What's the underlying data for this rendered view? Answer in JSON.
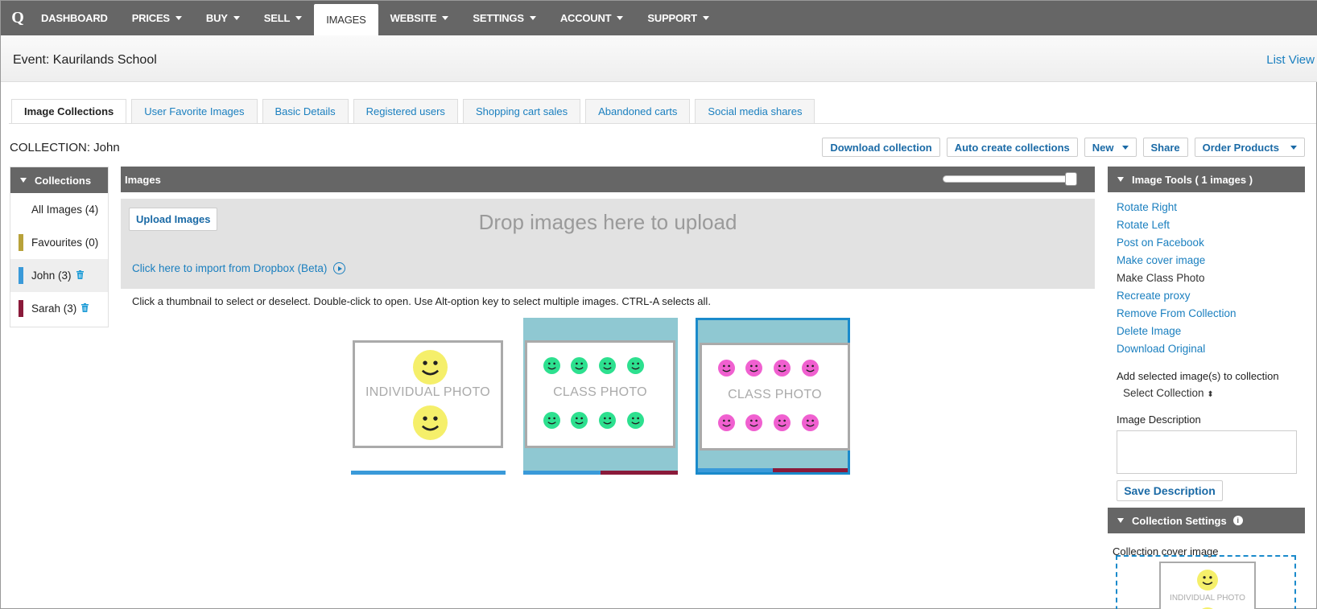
{
  "nav": {
    "logo": "Q",
    "items": [
      {
        "label": "DASHBOARD",
        "caret": false,
        "active": false
      },
      {
        "label": "PRICES",
        "caret": true,
        "active": false
      },
      {
        "label": "BUY",
        "caret": true,
        "active": false
      },
      {
        "label": "SELL",
        "caret": true,
        "active": false
      },
      {
        "label": "IMAGES",
        "caret": false,
        "active": true
      },
      {
        "label": "WEBSITE",
        "caret": true,
        "active": false
      },
      {
        "label": "SETTINGS",
        "caret": true,
        "active": false
      },
      {
        "label": "ACCOUNT",
        "caret": true,
        "active": false
      },
      {
        "label": "SUPPORT",
        "caret": true,
        "active": false
      }
    ]
  },
  "event": {
    "title": "Event: Kaurilands School",
    "list_view": "List View"
  },
  "tabs": [
    {
      "label": "Image Collections",
      "active": true
    },
    {
      "label": "User Favorite Images",
      "active": false
    },
    {
      "label": "Basic Details",
      "active": false
    },
    {
      "label": "Registered users",
      "active": false
    },
    {
      "label": "Shopping cart sales",
      "active": false
    },
    {
      "label": "Abandoned carts",
      "active": false
    },
    {
      "label": "Social media shares",
      "active": false
    }
  ],
  "collection": {
    "label": "COLLECTION: John",
    "actions": {
      "download": "Download collection",
      "auto_create": "Auto create collections",
      "new": "New",
      "share": "Share",
      "order": "Order Products"
    }
  },
  "collections_panel": {
    "title": "Collections",
    "items": [
      {
        "label": "All Images (4)",
        "color": "",
        "selected": false,
        "trash": false
      },
      {
        "label": "Favourites (0)",
        "color": "#b8a23a",
        "selected": false,
        "trash": false
      },
      {
        "label": "John (3)",
        "color": "#3a9ad9",
        "selected": true,
        "trash": true
      },
      {
        "label": "Sarah (3)",
        "color": "#8a1a3a",
        "selected": false,
        "trash": true
      }
    ]
  },
  "images_panel": {
    "title": "Images",
    "upload_button": "Upload Images",
    "drop_text": "Drop images here to upload",
    "dropbox_link": "Click here to import from Dropbox (Beta)",
    "help_text": "Click a thumbnail to select or deselect. Double-click to open. Use Alt-option key to select multiple images. CTRL-A selects all."
  },
  "thumbnails": [
    {
      "label": "INDIVIDUAL PHOTO",
      "background": "#ffffff",
      "face_color": "#f5ef6a",
      "selected": false,
      "bar_colors": [
        "#3a9ad9"
      ]
    },
    {
      "label": "CLASS PHOTO",
      "background": "#8fc8d2",
      "face_color": "#2de08f",
      "selected": false,
      "bar_colors": [
        "#3a9ad9",
        "#8a1a3a"
      ]
    },
    {
      "label": "CLASS PHOTO",
      "background": "#8fc8d2",
      "face_color": "#f060d0",
      "selected": true,
      "bar_colors": [
        "#3a9ad9",
        "#8a1a3a"
      ]
    }
  ],
  "tools": {
    "title": "Image Tools ( 1 images )",
    "links": [
      {
        "label": "Rotate Right",
        "plain": false
      },
      {
        "label": "Rotate Left",
        "plain": false
      },
      {
        "label": "Post on Facebook",
        "plain": false
      },
      {
        "label": "Make cover image",
        "plain": false
      },
      {
        "label": "Make Class Photo",
        "plain": true
      },
      {
        "label": "Recreate proxy",
        "plain": false
      },
      {
        "label": "Remove From Collection",
        "plain": false
      },
      {
        "label": "Delete Image",
        "plain": false
      },
      {
        "label": "Download Original",
        "plain": false
      }
    ],
    "add_label": "Add selected image(s) to collection",
    "select_collection": "Select Collection",
    "description_label": "Image Description",
    "save_button": "Save Description",
    "settings_title": "Collection Settings",
    "cover_label": "Collection cover image",
    "cover_text": "INDIVIDUAL PHOTO"
  },
  "colors": {
    "accent": "#1a7fbf",
    "header": "#666666",
    "selected_border": "#1a8acb"
  }
}
